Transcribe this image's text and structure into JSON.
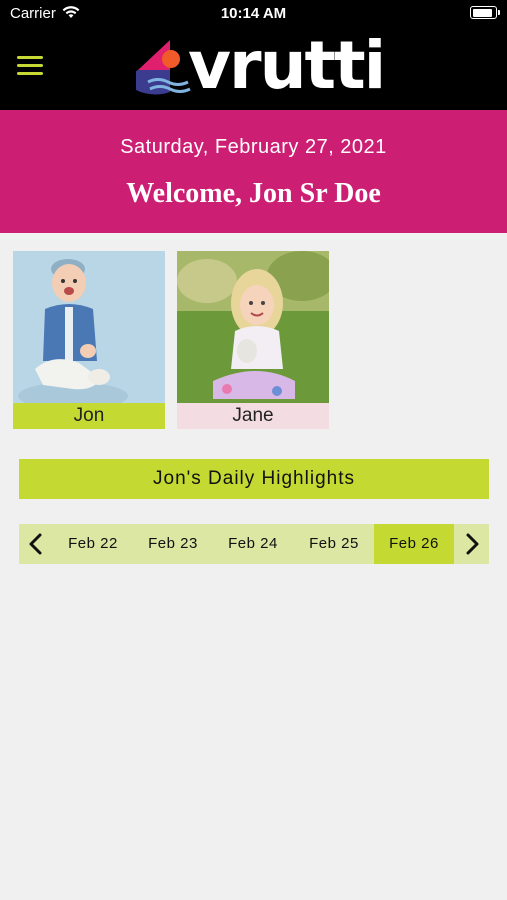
{
  "status_bar": {
    "carrier": "Carrier",
    "time": "10:14 AM",
    "battery_level": 0.9
  },
  "nav": {
    "logo_text": "vrutti",
    "menu_icon": "hamburger-menu-icon"
  },
  "header": {
    "date": "Saturday, February 27, 2021",
    "welcome": "Welcome, Jon Sr Doe"
  },
  "children": [
    {
      "name": "Jon",
      "photo": "baby-photo"
    },
    {
      "name": "Jane",
      "photo": "toddler-photo"
    }
  ],
  "highlights_title": "Jon's Daily Highlights",
  "date_selector": {
    "dates": [
      "Feb 22",
      "Feb 23",
      "Feb 24",
      "Feb 25",
      "Feb 26"
    ],
    "selected": "Feb 26",
    "prev_icon": "chevron-left-icon",
    "next_icon": "chevron-right-icon"
  },
  "colors": {
    "accent_green": "#c4d932",
    "header_pink": "#cc1f73",
    "background": "#f0f0f0"
  }
}
